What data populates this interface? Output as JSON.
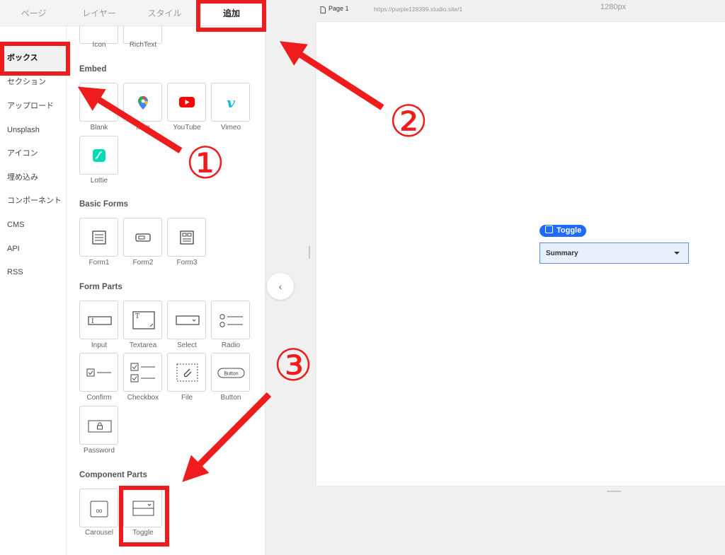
{
  "tabs": [
    {
      "label": "ページ"
    },
    {
      "label": "レイヤー"
    },
    {
      "label": "スタイル"
    },
    {
      "label": "追加"
    }
  ],
  "nav": [
    {
      "label": "ボックス"
    },
    {
      "label": "セクション"
    },
    {
      "label": "アップロード"
    },
    {
      "label": "Unsplash"
    },
    {
      "label": "アイコン"
    },
    {
      "label": "埋め込み"
    },
    {
      "label": "コンポーネント"
    },
    {
      "label": "CMS"
    },
    {
      "label": "API"
    },
    {
      "label": "RSS"
    }
  ],
  "panel": {
    "top_items": [
      {
        "label": "Icon"
      },
      {
        "label": "RichText"
      }
    ],
    "embed": {
      "title": "Embed",
      "items": [
        {
          "label": "Blank"
        },
        {
          "label": "Map"
        },
        {
          "label": "YouTube"
        },
        {
          "label": "Vimeo"
        },
        {
          "label": "Lottie"
        }
      ]
    },
    "basic_forms": {
      "title": "Basic Forms",
      "items": [
        {
          "label": "Form1"
        },
        {
          "label": "Form2"
        },
        {
          "label": "Form3"
        }
      ]
    },
    "form_parts": {
      "title": "Form Parts",
      "items": [
        {
          "label": "Input"
        },
        {
          "label": "Textarea"
        },
        {
          "label": "Select"
        },
        {
          "label": "Radio"
        },
        {
          "label": "Confirm"
        },
        {
          "label": "Checkbox"
        },
        {
          "label": "File"
        },
        {
          "label": "Button"
        },
        {
          "label": "Password"
        }
      ],
      "button_tile_text": "Button",
      "textarea_tile_text": "T",
      "input_tile_text": "I"
    },
    "component_parts": {
      "title": "Component Parts",
      "items": [
        {
          "label": "Carousel"
        },
        {
          "label": "Toggle"
        }
      ],
      "carousel_tile_text": "oo"
    }
  },
  "canvas": {
    "page_label": "Page 1",
    "url": "https://purple128399.studio.site/1",
    "width_label": "1280px",
    "collapse_icon": "‹",
    "toggle_badge": "Toggle",
    "summary_text": "Summary"
  },
  "annotations": [
    "①",
    "②",
    "③"
  ],
  "colors": {
    "annotation_red": "#ee1c1c",
    "accent_blue": "#1f6bff",
    "youtube_red": "#ff0000",
    "vimeo_blue": "#1ab7ea",
    "lottie_teal": "#00ddb3"
  }
}
